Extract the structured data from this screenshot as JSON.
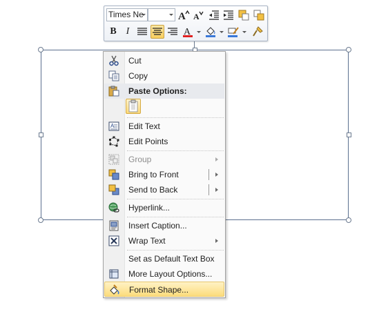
{
  "toolbar": {
    "font_name": "Times Ne",
    "font_size": "",
    "buttons": [
      {
        "name": "grow-font-icon",
        "glyph": "A˄"
      },
      {
        "name": "shrink-font-icon",
        "glyph": "A˅"
      },
      {
        "name": "decrease-indent-icon"
      },
      {
        "name": "increase-indent-icon"
      },
      {
        "name": "shape-fill-icon"
      },
      {
        "name": "shape-outline-icon"
      },
      {
        "name": "bold-icon",
        "glyph": "B"
      },
      {
        "name": "italic-icon",
        "glyph": "I"
      },
      {
        "name": "align-left-icon"
      },
      {
        "name": "align-center-icon"
      },
      {
        "name": "align-right-icon"
      },
      {
        "name": "font-color-icon",
        "glyph": "A"
      },
      {
        "name": "highlight-fill-icon"
      },
      {
        "name": "pen-color-icon"
      },
      {
        "name": "format-painter-icon"
      }
    ],
    "colors": {
      "font_color": "#e02020",
      "fill_color": "#3a78d8",
      "pen_color": "#3a78d8"
    }
  },
  "menu": {
    "cut": "Cut",
    "copy": "Copy",
    "paste_options": "Paste Options:",
    "edit_text": "Edit Text",
    "edit_points": "Edit Points",
    "group": "Group",
    "bring_to_front": "Bring to Front",
    "send_to_back": "Send to Back",
    "hyperlink": "Hyperlink...",
    "insert_caption": "Insert Caption...",
    "wrap_text": "Wrap Text",
    "set_default": "Set as Default Text Box",
    "more_layout": "More Layout Options...",
    "format_shape": "Format Shape..."
  },
  "colors": {
    "highlight": "#fcdc7c",
    "selection_border": "#5b6f8e",
    "menu_gutter": "#f0f0f0"
  }
}
